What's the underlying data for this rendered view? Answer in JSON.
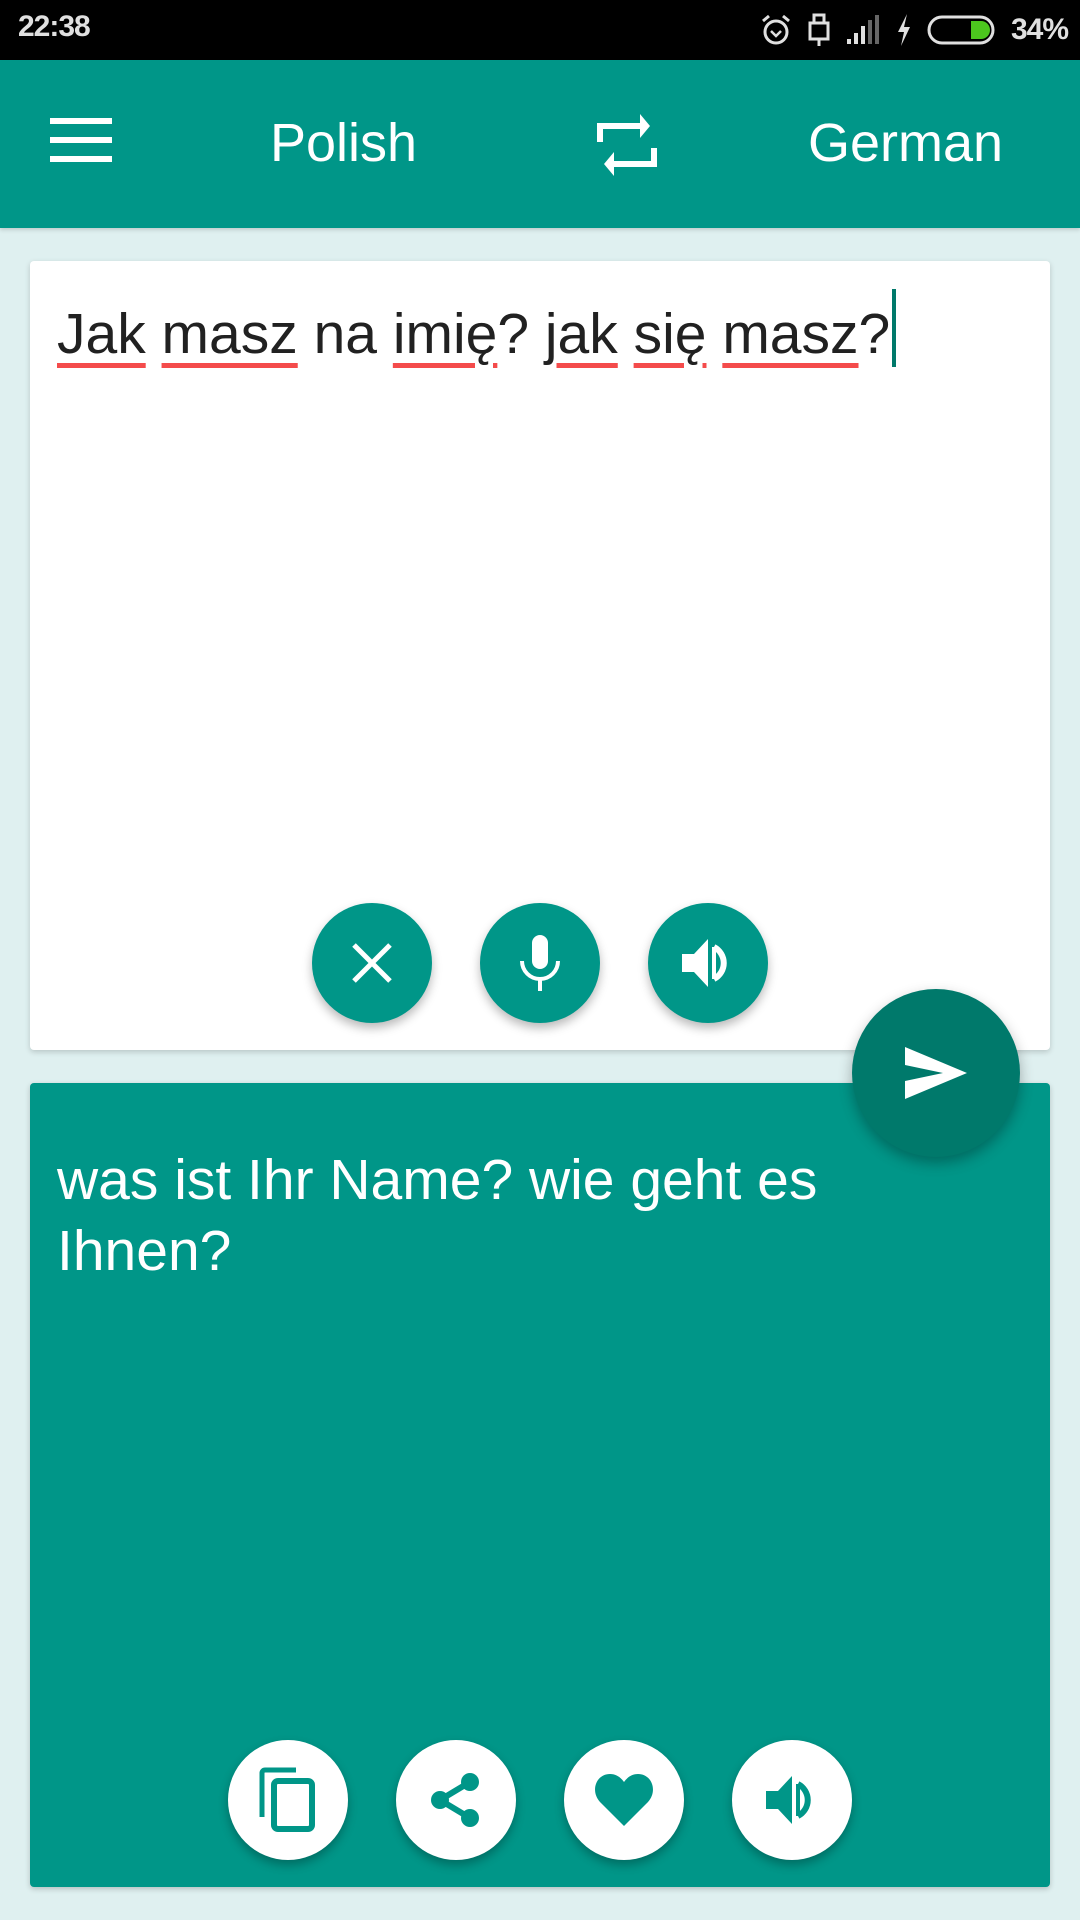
{
  "status_bar": {
    "time": "22:38",
    "battery_percent": "34%",
    "battery_level": 0.34,
    "icons": [
      "alarm-icon",
      "usb-icon",
      "signal-icon",
      "charging-icon",
      "battery-icon"
    ]
  },
  "app_bar": {
    "menu_icon": "hamburger-menu-icon",
    "source_language": "Polish",
    "swap_icon": "swap-languages-icon",
    "target_language": "German"
  },
  "input": {
    "words": [
      {
        "text": "Jak",
        "misspelled": true
      },
      {
        "text": "masz",
        "misspelled": true
      },
      {
        "text": "na",
        "misspelled": false
      },
      {
        "text": "imię",
        "misspelled": true
      },
      {
        "text": "? ",
        "misspelled": false
      },
      {
        "text": "jak",
        "misspelled": true
      },
      {
        "text": "się",
        "misspelled": true
      },
      {
        "text": "masz",
        "misspelled": true
      },
      {
        "text": "?",
        "misspelled": false
      }
    ],
    "full_text": "Jak masz na imię? jak się masz?",
    "buttons": [
      "clear-icon",
      "microphone-icon",
      "speaker-icon"
    ]
  },
  "translate_button": {
    "icon": "send-icon"
  },
  "output": {
    "text": "was ist Ihr Name? wie geht es Ihnen?",
    "buttons": [
      "copy-icon",
      "share-icon",
      "favorite-icon",
      "speaker-icon"
    ]
  },
  "colors": {
    "primary": "#009688",
    "primary_dark": "#00796b",
    "background": "#dff0f0",
    "spell_underline": "#f44b4b",
    "battery_fill": "#4cc71e"
  }
}
